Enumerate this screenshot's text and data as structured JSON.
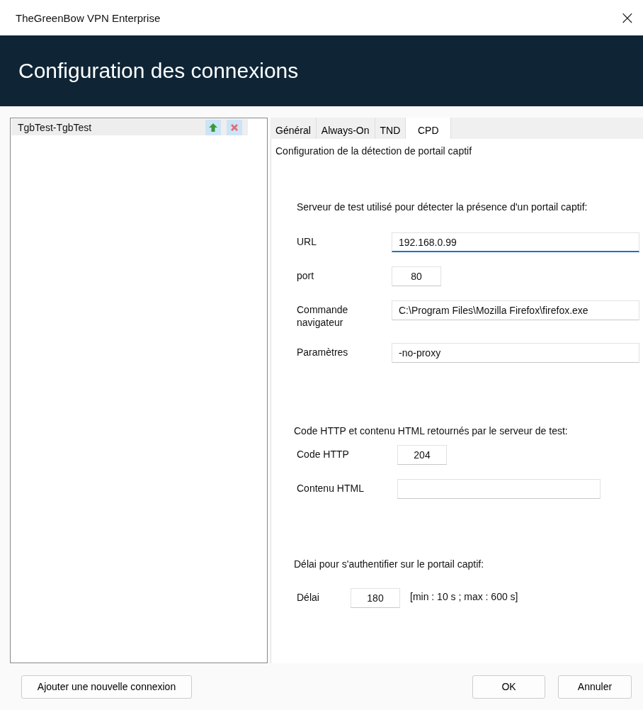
{
  "window": {
    "title": "TheGreenBow VPN Enterprise",
    "close": "×"
  },
  "header": {
    "title": "Configuration des connexions"
  },
  "connections": [
    {
      "name": "TgbTest-TgbTest",
      "selected": true
    }
  ],
  "tabs": [
    {
      "label": "Général",
      "selected": false
    },
    {
      "label": "Always-On",
      "selected": false
    },
    {
      "label": "TND",
      "selected": false
    },
    {
      "label": "CPD",
      "selected": true
    }
  ],
  "panel": {
    "subtitle": "Configuration de la détection de portail captif",
    "server": {
      "heading": "Serveur de test utilisé pour détecter la présence d'un portail captif:",
      "fields": [
        {
          "label": "URL",
          "value": "192.168.0.99",
          "kind": "wide",
          "focused": true
        },
        {
          "label": "port",
          "value": "80",
          "kind": "short",
          "focused": false
        },
        {
          "label": "Commande navigateur",
          "value": "C:\\Program Files\\Mozilla Firefox\\firefox.exe",
          "kind": "wide",
          "focused": false
        },
        {
          "label": "Paramètres",
          "value": "-no-proxy",
          "kind": "wide",
          "focused": false
        }
      ]
    },
    "http": {
      "heading": "Code HTTP et contenu HTML retournés par le serveur de test:",
      "fields": [
        {
          "label": "Code HTTP",
          "value": "204",
          "kind": "short",
          "focused": false
        },
        {
          "label": "Contenu HTML",
          "kind": "medium",
          "focused": false
        }
      ]
    },
    "delay": {
      "heading": "Délai pour s'authentifier sur le portail captif:",
      "label": "Délai",
      "value": "180",
      "hint": "[min : 10 s ; max : 600 s]"
    }
  },
  "buttons": {
    "add": "Ajouter une nouvelle connexion",
    "ok": "OK",
    "cancel": "Annuler"
  }
}
